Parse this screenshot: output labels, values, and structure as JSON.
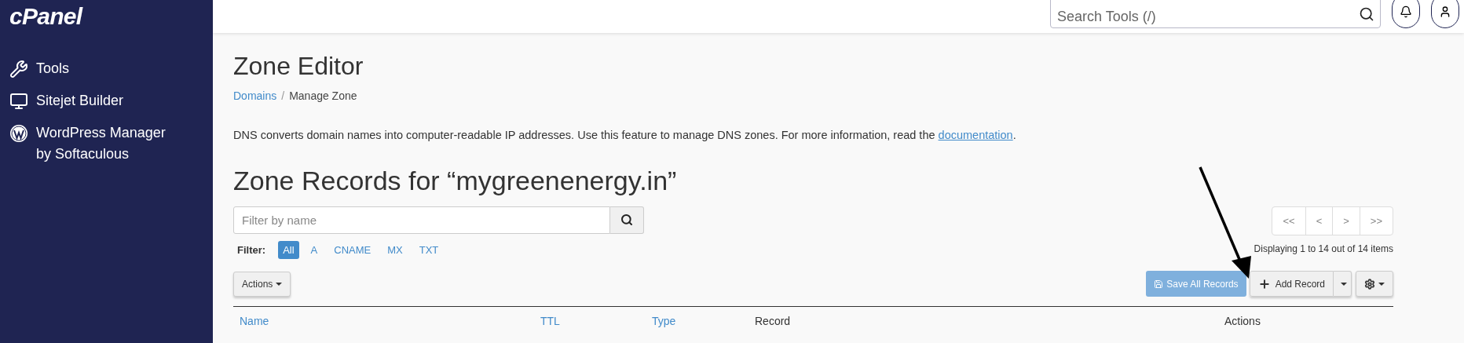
{
  "sidebar": {
    "logo": "cPanel",
    "items": [
      {
        "label": "Tools",
        "kind": "tools"
      },
      {
        "label": "Sitejet Builder",
        "kind": "sitejet"
      },
      {
        "label": "WordPress Manager by Softaculous",
        "kind": "wordpress"
      }
    ]
  },
  "header": {
    "search": {
      "placeholder": "Search Tools (/)"
    }
  },
  "page": {
    "title": "Zone Editor",
    "breadcrumb_separator": "/",
    "breadcrumb": [
      {
        "label": "Domains",
        "link": true
      },
      {
        "label": "Manage Zone",
        "link": false
      }
    ],
    "description": {
      "text": "DNS converts domain names into computer-readable IP addresses. Use this feature to manage DNS zones. For more information, read the ",
      "link": "documentation",
      "after": "."
    },
    "heading": "Zone Records for “mygreenenergy.in”"
  },
  "filter": {
    "placeholder": "Filter by name",
    "label": "Filter:",
    "types": [
      {
        "label": "All",
        "selected": true
      },
      {
        "label": "A",
        "selected": false
      },
      {
        "label": "CNAME",
        "selected": false
      },
      {
        "label": "MX",
        "selected": false
      },
      {
        "label": "TXT",
        "selected": false
      }
    ]
  },
  "pagination": {
    "buttons": [
      "<<",
      "<",
      ">",
      ">>"
    ],
    "summary": "Displaying 1 to 14 out of 14 items"
  },
  "toolbar": {
    "actions": "Actions",
    "save": {
      "label": "Save All Records",
      "disabled": true
    },
    "add": "Add Record"
  },
  "table": {
    "columns": [
      {
        "label": "Name",
        "sortable": true
      },
      {
        "label": "TTL",
        "sortable": true
      },
      {
        "label": "Type",
        "sortable": true
      },
      {
        "label": "Record",
        "sortable": false
      },
      {
        "label": "Actions",
        "sortable": false
      }
    ]
  }
}
